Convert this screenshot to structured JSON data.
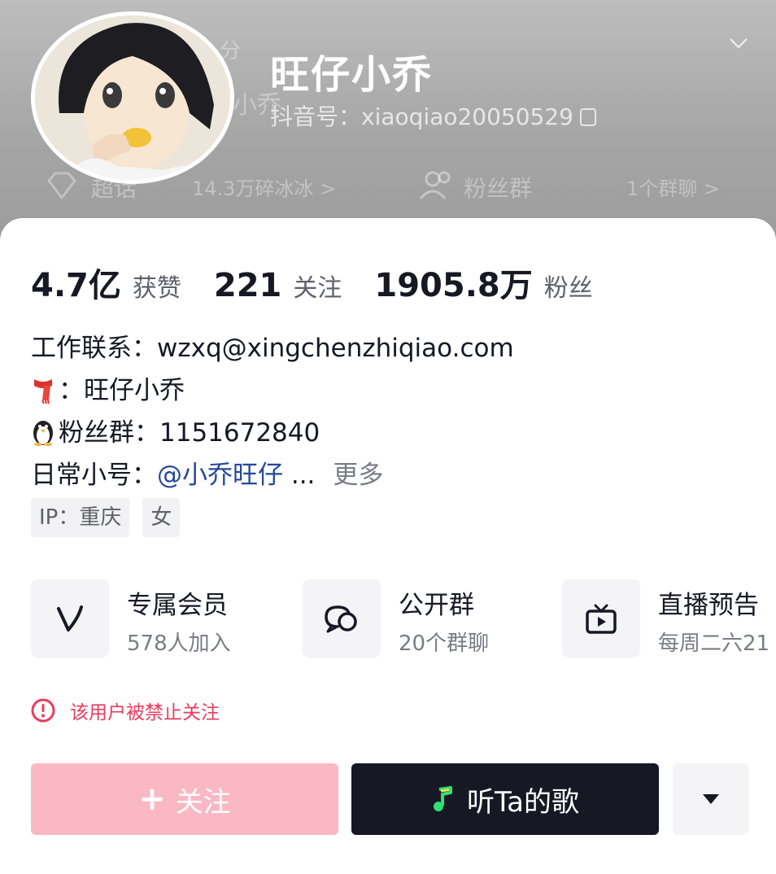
{
  "header": {
    "name": "旺仔小乔",
    "account": "抖音号：xiaoqiao20050529",
    "ghost_rating": "分",
    "ghost_alias": "小乔",
    "ghost_chaohua": "超话",
    "ghost_chaohua_count": "14.3万碎冰冰 >",
    "ghost_fans_group": "粉丝群",
    "ghost_group_count": "1个群聊 >"
  },
  "stats": [
    {
      "num": "4.7亿",
      "label": "获赞"
    },
    {
      "num": "221",
      "label": "关注"
    },
    {
      "num": "1905.8万",
      "label": "粉丝"
    }
  ],
  "bio": {
    "line1": "工作联系：wzxq@xingchenzhiqiao.com",
    "line2": "：旺仔小乔",
    "line3": "粉丝群：1151672840",
    "line4_prefix": "日常小号：",
    "line4_mention": "@小乔旺仔",
    "line4_ellipsis": " ...",
    "more": "更多"
  },
  "tags": [
    "IP：重庆",
    "女"
  ],
  "features": [
    {
      "title": "专属会员",
      "sub": "578人加入",
      "icon": "vip-v-icon"
    },
    {
      "title": "公开群",
      "sub": "20个群聊",
      "icon": "chat-bubbles-icon"
    },
    {
      "title": "直播预告",
      "sub": "每周二六21",
      "icon": "tv-play-icon"
    }
  ],
  "warning": "该用户被禁止关注",
  "buttons": {
    "follow": "关注",
    "song": "听Ta的歌"
  },
  "colors": {
    "warning": "#e83d5f",
    "follow_bg": "#f9b8c4",
    "dark_button": "#161823",
    "mention": "#25489a"
  }
}
